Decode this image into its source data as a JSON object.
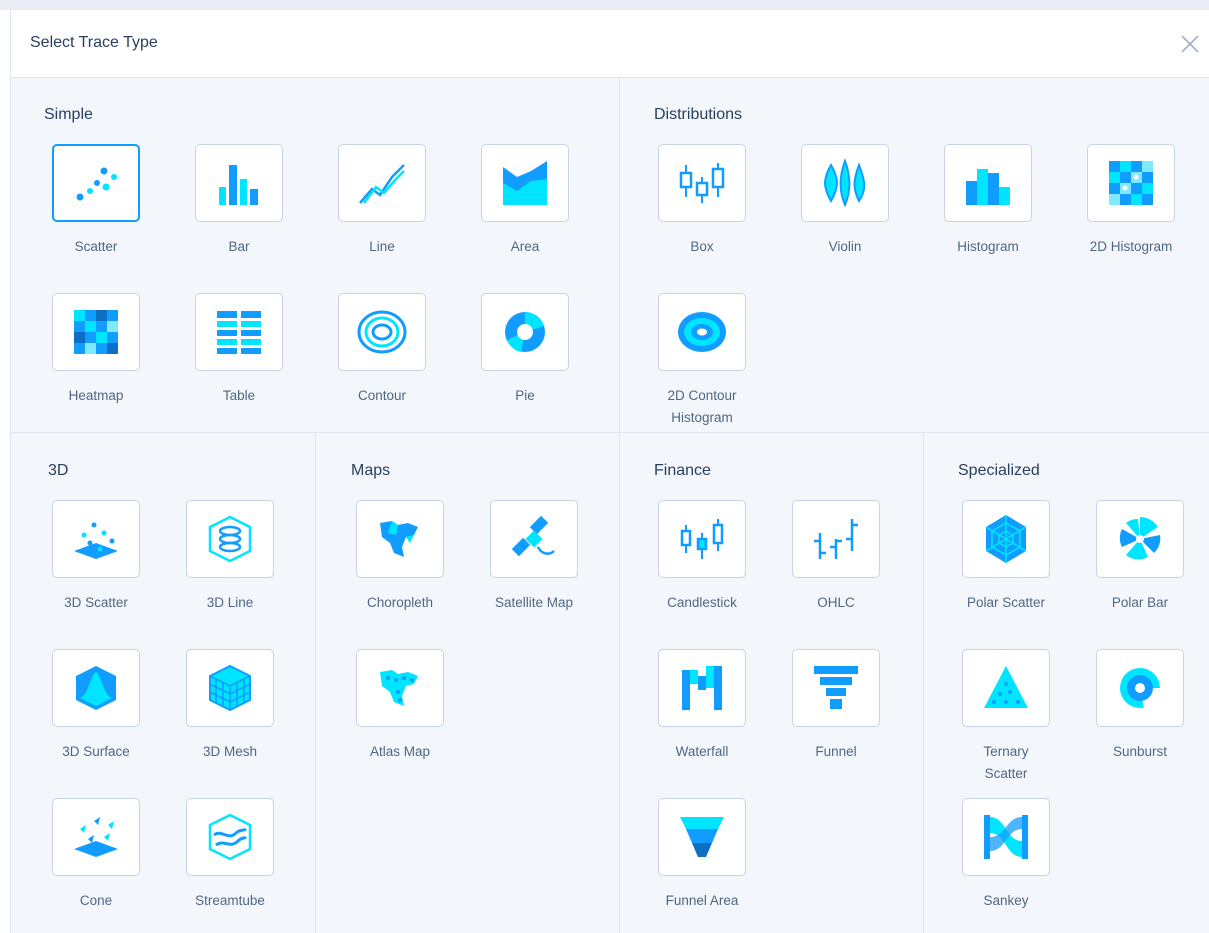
{
  "modal": {
    "title": "Select Trace Type"
  },
  "colors": {
    "accent": "#119dff",
    "accent_dark": "#0d6fc4",
    "accent_light": "#00e5ff",
    "text": "#506784",
    "border": "#c8d4e3",
    "panel": "#f3f6fa"
  },
  "sections": {
    "simple": {
      "title": "Simple",
      "items": [
        {
          "label": "Scatter",
          "icon": "scatter-icon"
        },
        {
          "label": "Bar",
          "icon": "bar-icon"
        },
        {
          "label": "Line",
          "icon": "line-icon"
        },
        {
          "label": "Area",
          "icon": "area-icon"
        },
        {
          "label": "Heatmap",
          "icon": "heatmap-icon"
        },
        {
          "label": "Table",
          "icon": "table-icon"
        },
        {
          "label": "Contour",
          "icon": "contour-icon"
        },
        {
          "label": "Pie",
          "icon": "pie-icon"
        }
      ]
    },
    "distributions": {
      "title": "Distributions",
      "items": [
        {
          "label": "Box",
          "icon": "box-icon"
        },
        {
          "label": "Violin",
          "icon": "violin-icon"
        },
        {
          "label": "Histogram",
          "icon": "histogram-icon"
        },
        {
          "label": "2D Histogram",
          "icon": "histogram-2d-icon"
        },
        {
          "label": "2D Contour Histogram",
          "icon": "contour-histogram-icon"
        }
      ]
    },
    "three_d": {
      "title": "3D",
      "items": [
        {
          "label": "3D Scatter",
          "icon": "scatter-3d-icon"
        },
        {
          "label": "3D Line",
          "icon": "line-3d-icon"
        },
        {
          "label": "3D Surface",
          "icon": "surface-3d-icon"
        },
        {
          "label": "3D Mesh",
          "icon": "mesh-3d-icon"
        },
        {
          "label": "Cone",
          "icon": "cone-icon"
        },
        {
          "label": "Streamtube",
          "icon": "streamtube-icon"
        }
      ]
    },
    "maps": {
      "title": "Maps",
      "items": [
        {
          "label": "Choropleth",
          "icon": "choropleth-icon"
        },
        {
          "label": "Satellite Map",
          "icon": "satellite-icon"
        },
        {
          "label": "Atlas Map",
          "icon": "atlas-map-icon"
        }
      ]
    },
    "finance": {
      "title": "Finance",
      "items": [
        {
          "label": "Candlestick",
          "icon": "candlestick-icon"
        },
        {
          "label": "OHLC",
          "icon": "ohlc-icon"
        },
        {
          "label": "Waterfall",
          "icon": "waterfall-icon"
        },
        {
          "label": "Funnel",
          "icon": "funnel-icon"
        },
        {
          "label": "Funnel Area",
          "icon": "funnel-area-icon"
        }
      ]
    },
    "specialized": {
      "title": "Specialized",
      "items": [
        {
          "label": "Polar Scatter",
          "icon": "polar-scatter-icon"
        },
        {
          "label": "Polar Bar",
          "icon": "polar-bar-icon"
        },
        {
          "label": "Ternary Scatter",
          "icon": "ternary-icon"
        },
        {
          "label": "Sunburst",
          "icon": "sunburst-icon"
        },
        {
          "label": "Sankey",
          "icon": "sankey-icon"
        }
      ]
    }
  }
}
